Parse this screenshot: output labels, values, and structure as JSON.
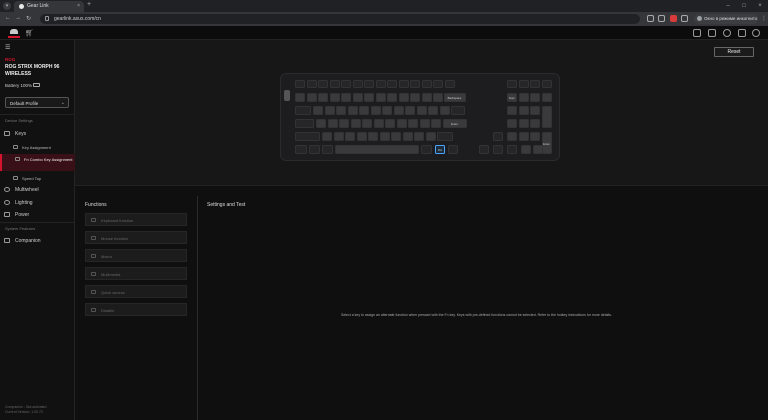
{
  "browser": {
    "tab_title": "Gear Link",
    "url": "gearlink.asus.com/cn",
    "profile_chip": "Окно в режиме инкогнито"
  },
  "sidebar": {
    "brand": "ROG",
    "device_name": "ROG STRIX MORPH 96 WIRELESS",
    "battery": "Battery 100%",
    "profile": "Default Profile",
    "device_settings_label": "Device Settings",
    "items": [
      {
        "label": "Keys",
        "icon": "keyboard-icon"
      },
      {
        "label": "Multiwheel",
        "icon": "wheel-icon"
      },
      {
        "label": "Lighting",
        "icon": "lighting-icon"
      },
      {
        "label": "Power",
        "icon": "battery-icon"
      }
    ],
    "sub_items": [
      {
        "label": "Key Assignment"
      },
      {
        "label": "Fn Combo Key Assignment"
      },
      {
        "label": "Speed Tap"
      }
    ],
    "system_features_label": "System Features",
    "companion": "Companion",
    "version_line1": "Companion - Not activated",
    "version_line2": "Current Version: 1.00.72"
  },
  "main": {
    "reset": "Reset",
    "functions_title": "Functions",
    "settings_title": "Settings and Test",
    "functions": [
      {
        "label": "Keyboard function",
        "icon": "keyboard-icon"
      },
      {
        "label": "Mouse function",
        "icon": "mouse-icon"
      },
      {
        "label": "Macro",
        "icon": "macro-icon"
      },
      {
        "label": "Multimedia",
        "icon": "multimedia-icon"
      },
      {
        "label": "Quick access",
        "icon": "quick-access-icon"
      },
      {
        "label": "Disable",
        "icon": "disable-icon"
      }
    ],
    "hint": "Select a key to assign an alternate function when pressed with the Fn key. Keys with pre-defined functions cannot be selected. Refer to the hotkey instructions for more details."
  },
  "keys": {
    "backspace": "Backspace",
    "num": "Num",
    "enter": "Enter",
    "space": "",
    "fn": "Fn",
    "num_enter": "Enter"
  }
}
